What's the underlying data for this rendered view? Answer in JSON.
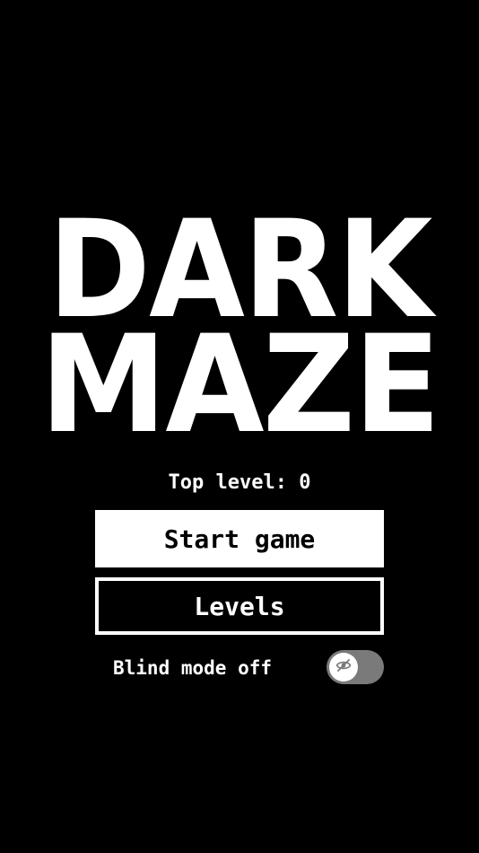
{
  "title": {
    "line1": "DARK",
    "line2": "MAZE"
  },
  "stats": {
    "top_level_label": "Top level: 0",
    "top_level_value": 0
  },
  "menu": {
    "start_label": "Start game",
    "levels_label": "Levels"
  },
  "blind_mode": {
    "label": "Blind mode off",
    "enabled": false,
    "icon": "eye-off-icon"
  },
  "colors": {
    "background": "#000000",
    "foreground": "#ffffff",
    "toggle_track": "#7a7a7a"
  }
}
